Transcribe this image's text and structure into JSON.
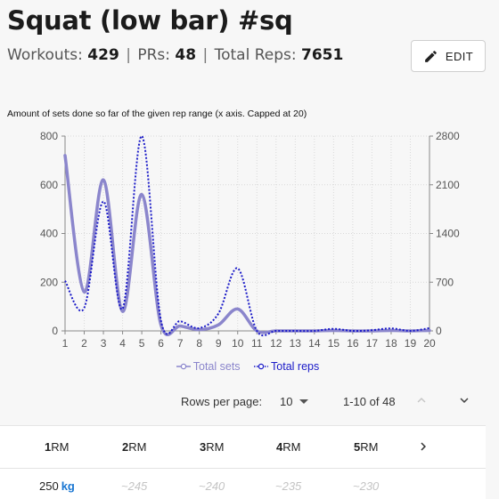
{
  "header": {
    "title": "Squat (low bar) #sq",
    "workouts_label": "Workouts:",
    "workouts_value": "429",
    "prs_label": "PRs:",
    "prs_value": "48",
    "total_reps_label": "Total Reps:",
    "total_reps_value": "7651",
    "separator": "|",
    "edit_label": "EDIT"
  },
  "chart_caption": "Amount of sets done so far of the given rep range (x axis. Capped at 20)",
  "chart_data": {
    "type": "line",
    "title": "Amount of sets done so far of the given rep range (x axis. Capped at 20)",
    "x": [
      1,
      2,
      3,
      4,
      5,
      6,
      7,
      8,
      9,
      10,
      11,
      12,
      13,
      14,
      15,
      16,
      17,
      18,
      19,
      20
    ],
    "xlim": [
      1,
      20
    ],
    "series": [
      {
        "name": "Total sets",
        "axis": "left",
        "color": "#8b86cc",
        "style": "solid",
        "values": [
          720,
          160,
          620,
          80,
          560,
          25,
          20,
          5,
          25,
          90,
          0,
          0,
          0,
          0,
          2,
          0,
          0,
          2,
          0,
          2
        ]
      },
      {
        "name": "Total reps",
        "axis": "right",
        "color": "#1a1ac8",
        "style": "dotted",
        "values": [
          720,
          330,
          1860,
          320,
          2800,
          150,
          140,
          40,
          250,
          900,
          0,
          0,
          0,
          0,
          30,
          0,
          10,
          36,
          0,
          40
        ]
      }
    ],
    "y_left": {
      "ticks": [
        "0",
        "200",
        "400",
        "600",
        "800"
      ],
      "lim": [
        0,
        800
      ]
    },
    "y_right": {
      "ticks": [
        "0",
        "700",
        "1400",
        "2100",
        "2800"
      ],
      "lim": [
        0,
        2800
      ]
    },
    "x_ticks": [
      "1",
      "2",
      "3",
      "4",
      "5",
      "6",
      "7",
      "8",
      "9",
      "10",
      "11",
      "12",
      "13",
      "14",
      "15",
      "16",
      "17",
      "18",
      "19",
      "20"
    ],
    "grid": true,
    "legend_position": "bottom"
  },
  "legend": {
    "sets_label": "Total sets",
    "reps_label": "Total reps"
  },
  "pagination": {
    "rows_per_page_label": "Rows per page:",
    "rows_per_page_value": "10",
    "range_text": "1-10 of 48"
  },
  "table": {
    "columns": [
      {
        "bold": "1",
        "rest": "RM"
      },
      {
        "bold": "2",
        "rest": "RM"
      },
      {
        "bold": "3",
        "rest": "RM"
      },
      {
        "bold": "4",
        "rest": "RM"
      },
      {
        "bold": "5",
        "rest": "RM"
      }
    ],
    "first_row": {
      "main_value": "250",
      "main_unit": "kg",
      "estimates": [
        "~245",
        "~240",
        "~235",
        "~230"
      ]
    }
  },
  "colors": {
    "sets": "#8b86cc",
    "reps": "#1a1ac8",
    "unit_accent": "#1976d2"
  }
}
